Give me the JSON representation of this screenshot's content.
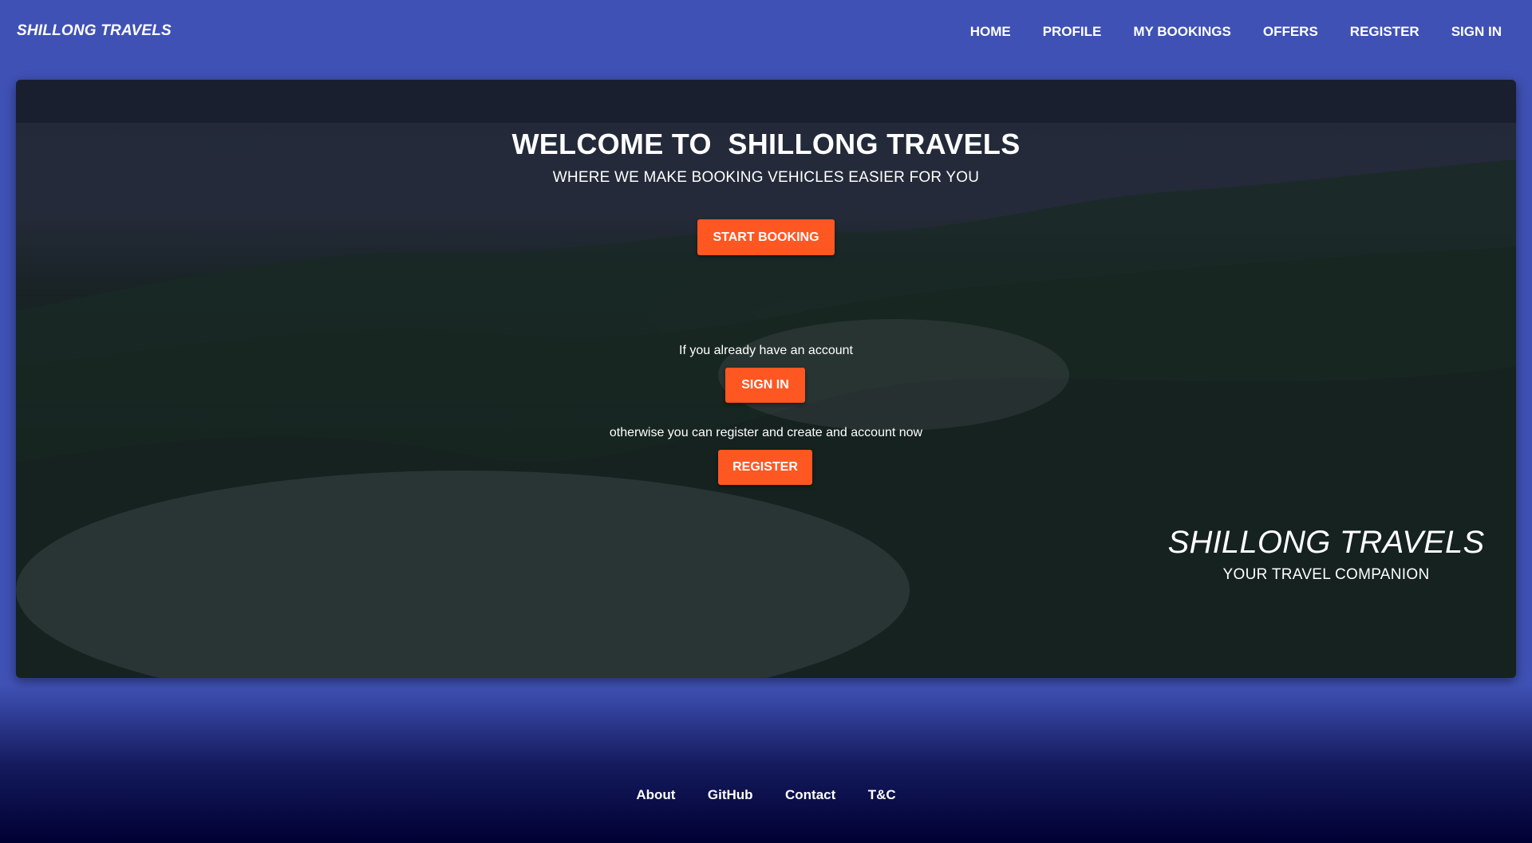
{
  "navbar": {
    "brand": "SHILLONG TRAVELS",
    "links": [
      "HOME",
      "PROFILE",
      "MY BOOKINGS",
      "OFFERS",
      "REGISTER",
      "SIGN IN"
    ]
  },
  "hero": {
    "title": "WELCOME TO  SHILLONG TRAVELS",
    "subtitle": "WHERE WE MAKE BOOKING VEHICLES EASIER FOR YOU",
    "start_booking_label": "START BOOKING",
    "signin_note": "If you already have an account",
    "signin_label": "SIGN IN",
    "register_note": "otherwise you can register and create and account now",
    "register_label": "REGISTER",
    "side_brand": "SHILLONG TRAVELS",
    "side_tagline": "YOUR TRAVEL COMPANION"
  },
  "footer": {
    "links": [
      "About",
      "GitHub",
      "Contact",
      "T&C"
    ]
  },
  "colors": {
    "primary": "#3f51b5",
    "accent": "#ff5722",
    "footer_dark": "#000033"
  }
}
